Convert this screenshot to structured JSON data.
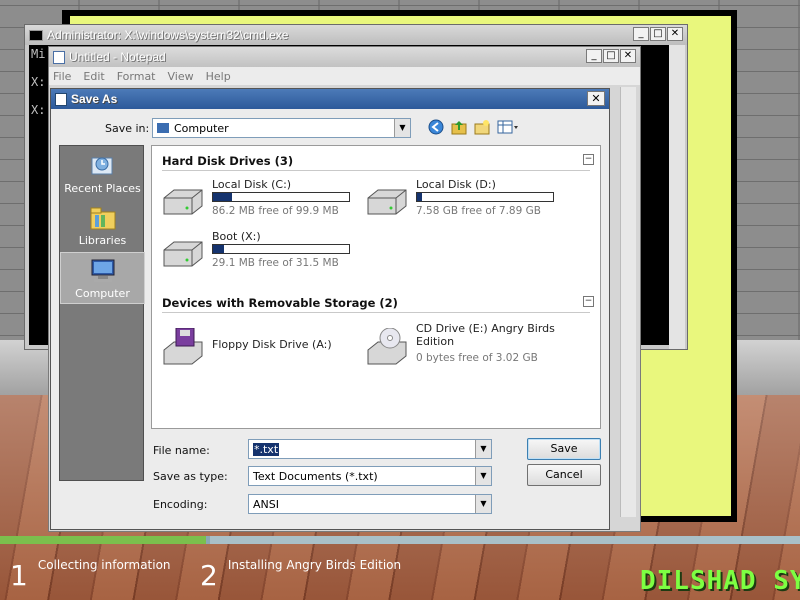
{
  "cmd": {
    "title": "Administrator: X:\\windows\\system32\\cmd.exe",
    "lines": [
      "Mi",
      "",
      "X:",
      "",
      "X:"
    ]
  },
  "notepad": {
    "title": "Untitled - Notepad",
    "menu": [
      "File",
      "Edit",
      "Format",
      "View",
      "Help"
    ]
  },
  "saveas": {
    "title": "Save As",
    "save_in_label": "Save in:",
    "save_in_value": "Computer",
    "places": [
      {
        "label": "Recent Places",
        "icon": "recent-places-icon"
      },
      {
        "label": "Libraries",
        "icon": "libraries-icon"
      },
      {
        "label": "Computer",
        "icon": "computer-icon"
      }
    ],
    "groups": [
      {
        "header": "Hard Disk Drives (3)",
        "drives": [
          {
            "name": "Local Disk (C:)",
            "free": "86.2 MB free of 99.9 MB",
            "used_fraction": 0.14
          },
          {
            "name": "Local Disk (D:)",
            "free": "7.58 GB free of 7.89 GB",
            "used_fraction": 0.04
          },
          {
            "name": "Boot (X:)",
            "free": "29.1 MB free of 31.5 MB",
            "used_fraction": 0.08
          }
        ]
      },
      {
        "header": "Devices with Removable Storage (2)",
        "drives": [
          {
            "name": "Floppy Disk Drive (A:)",
            "free": ""
          },
          {
            "name": "CD Drive (E:) Angry Birds Edition",
            "free": "0 bytes free of 3.02 GB"
          }
        ]
      }
    ],
    "file_name_label": "File name:",
    "file_name_value": "*.txt",
    "save_type_label": "Save as type:",
    "save_type_value": "Text Documents (*.txt)",
    "encoding_label": "Encoding:",
    "encoding_value": "ANSI",
    "save_button": "Save",
    "cancel_button": "Cancel"
  },
  "setup": {
    "steps": [
      {
        "num": "1",
        "label": "Collecting information"
      },
      {
        "num": "2",
        "label": "Installing Angry Birds Edition"
      }
    ],
    "progress_fraction": 0.26,
    "brand": "DILSHAD SYS"
  }
}
